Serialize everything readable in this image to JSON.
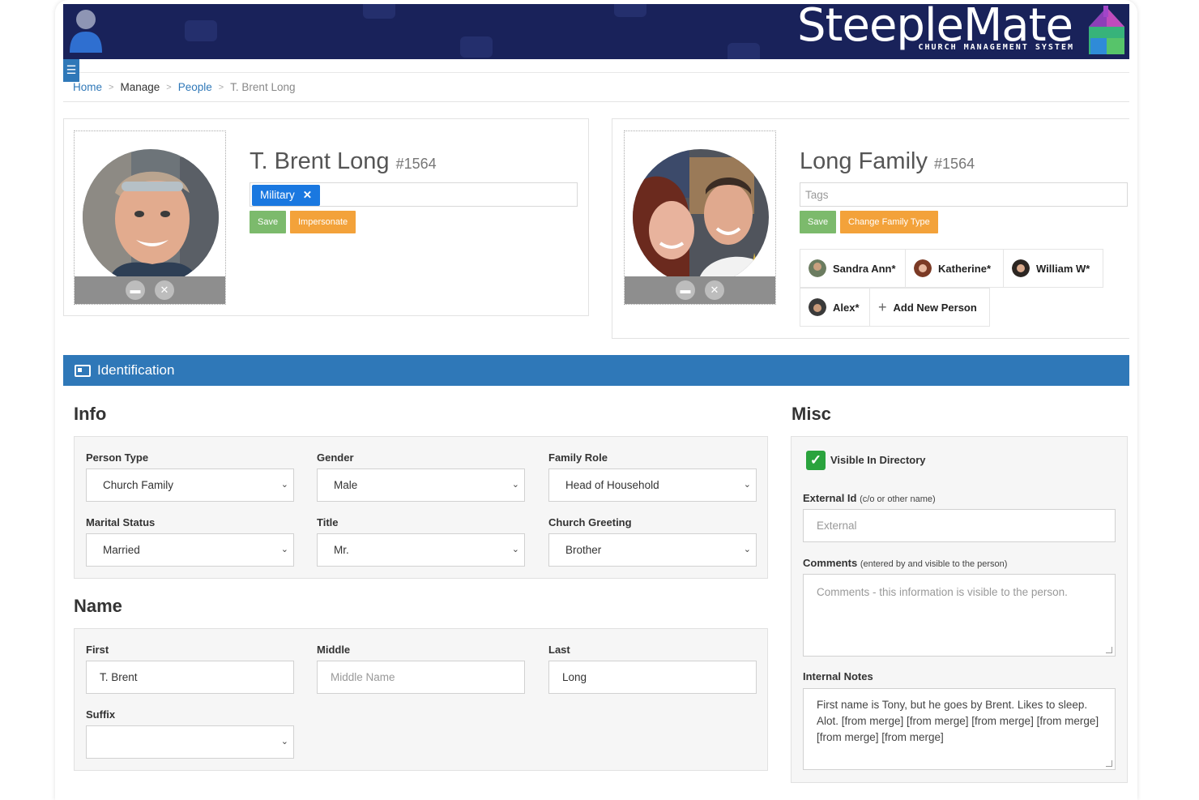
{
  "header": {
    "logo_text": "SteepleMate",
    "logo_subtitle": "CHURCH MANAGEMENT SYSTEM"
  },
  "breadcrumb": {
    "home": "Home",
    "manage": "Manage",
    "people": "People",
    "current": "T. Brent Long",
    "separator": ">"
  },
  "person": {
    "name": "T. Brent Long",
    "id": "#1564",
    "tags": [
      {
        "label": "Military",
        "remove": "✕"
      }
    ],
    "save_label": "Save",
    "impersonate_label": "Impersonate"
  },
  "family": {
    "name": "Long Family",
    "id": "#1564",
    "tags_placeholder": "Tags",
    "save_label": "Save",
    "change_type_label": "Change Family Type",
    "members": [
      "Sandra Ann*",
      "Katherine*",
      "William W*",
      "Alex*"
    ],
    "add_new_label": "Add New Person"
  },
  "section": {
    "title": "Identification"
  },
  "info": {
    "heading": "Info",
    "person_type_label": "Person Type",
    "person_type_value": "Church Family",
    "gender_label": "Gender",
    "gender_value": "Male",
    "family_role_label": "Family Role",
    "family_role_value": "Head of Household",
    "marital_status_label": "Marital Status",
    "marital_status_value": "Married",
    "title_label": "Title",
    "title_value": "Mr.",
    "church_greeting_label": "Church Greeting",
    "church_greeting_value": "Brother"
  },
  "name": {
    "heading": "Name",
    "first_label": "First",
    "first_value": "T. Brent",
    "middle_label": "Middle",
    "middle_placeholder": "Middle Name",
    "last_label": "Last",
    "last_value": "Long",
    "suffix_label": "Suffix",
    "suffix_value": ""
  },
  "misc": {
    "heading": "Misc",
    "visible_label": "Visible In Directory",
    "visible_checked": true,
    "external_id_label": "External Id",
    "external_id_hint": "(c/o or other name)",
    "external_id_placeholder": "External",
    "comments_label": "Comments",
    "comments_hint": "(entered by and visible to the person)",
    "comments_placeholder": "Comments - this information is visible to the person.",
    "internal_notes_label": "Internal Notes",
    "internal_notes_value": "First name is Tony, but he goes by Brent. Likes to sleep. Alot.  [from merge]  [from merge]  [from merge]  [from merge]  [from merge]  [from merge]"
  },
  "colors": {
    "header_bg": "#19225a",
    "accent_blue": "#2f78b8",
    "tag_blue": "#1a78e0",
    "save_green": "#7cba6c",
    "action_orange": "#f3a23a",
    "check_green": "#2aa33d"
  },
  "icons": {
    "user": "user-icon",
    "menu": "hamburger-icon",
    "folder": "folder-icon",
    "remove": "close-icon",
    "id_card": "id-card-icon",
    "plus": "plus-icon",
    "chevron": "chevron-down-icon",
    "check": "checkmark-icon"
  }
}
